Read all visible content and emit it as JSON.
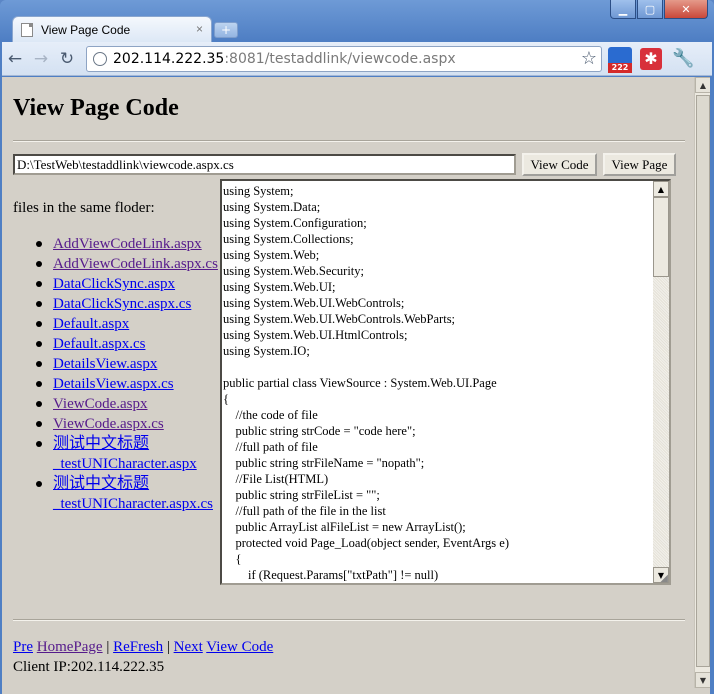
{
  "tab": {
    "title": "View Page Code",
    "close": "×",
    "new_tab": "+"
  },
  "window": {
    "minimize": "▁",
    "maximize": "▢",
    "close": "✕"
  },
  "toolbar": {
    "back": "←",
    "forward": "→",
    "reload": "↻",
    "url_host": "202.114.222.35",
    "url_rest": ":8081/testaddlink/viewcode.aspx",
    "star": "☆",
    "ext1_badge": "222",
    "ext2_glyph": "✱",
    "wrench": "🔧"
  },
  "page": {
    "title": "View Page Code",
    "path_value": "D:\\TestWeb\\testaddlink\\viewcode.aspx.cs",
    "view_code_label": "View Code",
    "view_page_label": "View Page",
    "files_label": "files in the same floder:",
    "files": [
      {
        "name": "AddViewCodeLink.aspx",
        "visited": true
      },
      {
        "name": "AddViewCodeLink.aspx.cs",
        "visited": true
      },
      {
        "name": "DataClickSync.aspx",
        "visited": false
      },
      {
        "name": "DataClickSync.aspx.cs",
        "visited": false
      },
      {
        "name": "Default.aspx",
        "visited": false
      },
      {
        "name": "Default.aspx.cs",
        "visited": false
      },
      {
        "name": "DetailsView.aspx",
        "visited": false
      },
      {
        "name": "DetailsView.aspx.cs",
        "visited": false
      },
      {
        "name": "ViewCode.aspx",
        "visited": true
      },
      {
        "name": "ViewCode.aspx.cs",
        "visited": true
      }
    ],
    "unicode_files": [
      {
        "line1": "测试中文标题",
        "line2": "_testUNICharacter.aspx"
      },
      {
        "line1": "测试中文标题",
        "line2": "_testUNICharacter.aspx.cs"
      }
    ],
    "code": "using System;\nusing System.Data;\nusing System.Configuration;\nusing System.Collections;\nusing System.Web;\nusing System.Web.Security;\nusing System.Web.UI;\nusing System.Web.UI.WebControls;\nusing System.Web.UI.WebControls.WebParts;\nusing System.Web.UI.HtmlControls;\nusing System.IO;\n\npublic partial class ViewSource : System.Web.UI.Page\n{\n    //the code of file\n    public string strCode = \"code here\";\n    //full path of file\n    public string strFileName = \"nopath\";\n    //File List(HTML)\n    public string strFileList = \"\";\n    //full path of the file in the list\n    public ArrayList alFileList = new ArrayList();\n    protected void Page_Load(object sender, EventArgs e)\n    {\n        if (Request.Params[\"txtPath\"] != null)",
    "footer": {
      "pre": "Pre",
      "homepage": "HomePage",
      "sep": "|",
      "refresh": "ReFresh",
      "next": "Next",
      "view_code": "View Code",
      "client_ip": "Client IP:202.114.222.35"
    }
  }
}
